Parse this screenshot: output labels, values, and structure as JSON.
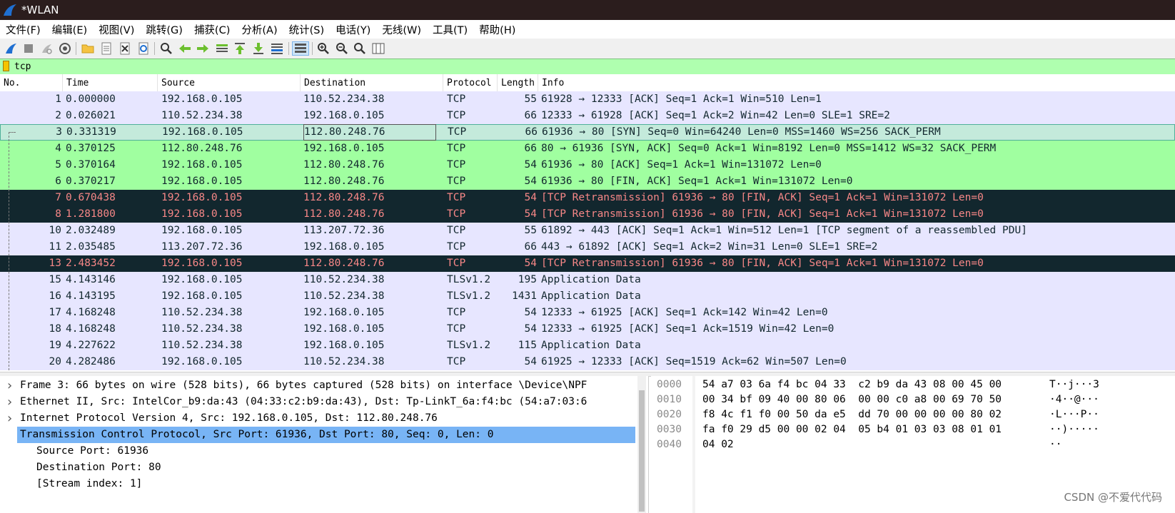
{
  "window": {
    "title": "*WLAN"
  },
  "menu": [
    "文件(F)",
    "编辑(E)",
    "视图(V)",
    "跳转(G)",
    "捕获(C)",
    "分析(A)",
    "统计(S)",
    "电话(Y)",
    "无线(W)",
    "工具(T)",
    "帮助(H)"
  ],
  "toolbar_icons": [
    "start-capture-icon",
    "stop-capture-icon",
    "restart-capture-icon",
    "capture-options-icon",
    "open-file-icon",
    "save-file-icon",
    "close-file-icon",
    "reload-file-icon",
    "find-packet-icon",
    "go-back-icon",
    "go-forward-icon",
    "go-to-packet-icon",
    "first-packet-icon",
    "last-packet-icon",
    "auto-scroll-icon",
    "colorize-icon",
    "zoom-in-icon",
    "zoom-out-icon",
    "zoom-normal-icon",
    "resize-columns-icon"
  ],
  "filter": {
    "value": "tcp"
  },
  "columns": {
    "no": "No.",
    "time": "Time",
    "source": "Source",
    "destination": "Destination",
    "protocol": "Protocol",
    "length": "Length",
    "info": "Info"
  },
  "colors": {
    "tcp": "#e7e6ff",
    "syn": "#a0ffa0",
    "selected": "#c4eadb",
    "bad": "#12272e",
    "bad_text": "#f78787"
  },
  "packets": [
    {
      "no": "1",
      "time": "0.000000",
      "source": "192.168.0.105",
      "destination": "110.52.234.38",
      "protocol": "TCP",
      "length": "55",
      "info": "61928 → 12333 [ACK] Seq=1 Ack=1 Win=510 Len=1",
      "style": "tcp"
    },
    {
      "no": "2",
      "time": "0.026021",
      "source": "110.52.234.38",
      "destination": "192.168.0.105",
      "protocol": "TCP",
      "length": "66",
      "info": "12333 → 61928 [ACK] Seq=1 Ack=2 Win=42 Len=0 SLE=1 SRE=2",
      "style": "tcp"
    },
    {
      "no": "3",
      "time": "0.331319",
      "source": "192.168.0.105",
      "destination": "112.80.248.76",
      "protocol": "TCP",
      "length": "66",
      "info": "61936 → 80 [SYN] Seq=0 Win=64240 Len=0 MSS=1460 WS=256 SACK_PERM",
      "style": "selected"
    },
    {
      "no": "4",
      "time": "0.370125",
      "source": "112.80.248.76",
      "destination": "192.168.0.105",
      "protocol": "TCP",
      "length": "66",
      "info": "80 → 61936 [SYN, ACK] Seq=0 Ack=1 Win=8192 Len=0 MSS=1412 WS=32 SACK_PERM",
      "style": "syn"
    },
    {
      "no": "5",
      "time": "0.370164",
      "source": "192.168.0.105",
      "destination": "112.80.248.76",
      "protocol": "TCP",
      "length": "54",
      "info": "61936 → 80 [ACK] Seq=1 Ack=1 Win=131072 Len=0",
      "style": "syn"
    },
    {
      "no": "6",
      "time": "0.370217",
      "source": "192.168.0.105",
      "destination": "112.80.248.76",
      "protocol": "TCP",
      "length": "54",
      "info": "61936 → 80 [FIN, ACK] Seq=1 Ack=1 Win=131072 Len=0",
      "style": "syn"
    },
    {
      "no": "7",
      "time": "0.670438",
      "source": "192.168.0.105",
      "destination": "112.80.248.76",
      "protocol": "TCP",
      "length": "54",
      "info": "[TCP Retransmission] 61936 → 80 [FIN, ACK] Seq=1 Ack=1 Win=131072 Len=0",
      "style": "bad"
    },
    {
      "no": "8",
      "time": "1.281800",
      "source": "192.168.0.105",
      "destination": "112.80.248.76",
      "protocol": "TCP",
      "length": "54",
      "info": "[TCP Retransmission] 61936 → 80 [FIN, ACK] Seq=1 Ack=1 Win=131072 Len=0",
      "style": "bad"
    },
    {
      "no": "10",
      "time": "2.032489",
      "source": "192.168.0.105",
      "destination": "113.207.72.36",
      "protocol": "TCP",
      "length": "55",
      "info": "61892 → 443 [ACK] Seq=1 Ack=1 Win=512 Len=1 [TCP segment of a reassembled PDU]",
      "style": "tcp"
    },
    {
      "no": "11",
      "time": "2.035485",
      "source": "113.207.72.36",
      "destination": "192.168.0.105",
      "protocol": "TCP",
      "length": "66",
      "info": "443 → 61892 [ACK] Seq=1 Ack=2 Win=31 Len=0 SLE=1 SRE=2",
      "style": "tcp"
    },
    {
      "no": "13",
      "time": "2.483452",
      "source": "192.168.0.105",
      "destination": "112.80.248.76",
      "protocol": "TCP",
      "length": "54",
      "info": "[TCP Retransmission] 61936 → 80 [FIN, ACK] Seq=1 Ack=1 Win=131072 Len=0",
      "style": "bad"
    },
    {
      "no": "15",
      "time": "4.143146",
      "source": "192.168.0.105",
      "destination": "110.52.234.38",
      "protocol": "TLSv1.2",
      "length": "195",
      "info": "Application Data",
      "style": "tcp"
    },
    {
      "no": "16",
      "time": "4.143195",
      "source": "192.168.0.105",
      "destination": "110.52.234.38",
      "protocol": "TLSv1.2",
      "length": "1431",
      "info": "Application Data",
      "style": "tcp"
    },
    {
      "no": "17",
      "time": "4.168248",
      "source": "110.52.234.38",
      "destination": "192.168.0.105",
      "protocol": "TCP",
      "length": "54",
      "info": "12333 → 61925 [ACK] Seq=1 Ack=142 Win=42 Len=0",
      "style": "tcp"
    },
    {
      "no": "18",
      "time": "4.168248",
      "source": "110.52.234.38",
      "destination": "192.168.0.105",
      "protocol": "TCP",
      "length": "54",
      "info": "12333 → 61925 [ACK] Seq=1 Ack=1519 Win=42 Len=0",
      "style": "tcp"
    },
    {
      "no": "19",
      "time": "4.227622",
      "source": "110.52.234.38",
      "destination": "192.168.0.105",
      "protocol": "TLSv1.2",
      "length": "115",
      "info": "Application Data",
      "style": "tcp"
    },
    {
      "no": "20",
      "time": "4.282486",
      "source": "192.168.0.105",
      "destination": "110.52.234.38",
      "protocol": "TCP",
      "length": "54",
      "info": "61925 → 12333 [ACK] Seq=1519 Ack=62 Win=507 Len=0",
      "style": "tcp"
    }
  ],
  "details": [
    {
      "text": "Frame 3: 66 bytes on wire (528 bits), 66 bytes captured (528 bits) on interface \\Device\\NPF",
      "expanded": false,
      "level": 0
    },
    {
      "text": "Ethernet II, Src: IntelCor_b9:da:43 (04:33:c2:b9:da:43), Dst: Tp-LinkT_6a:f4:bc (54:a7:03:6",
      "expanded": false,
      "level": 0
    },
    {
      "text": "Internet Protocol Version 4, Src: 192.168.0.105, Dst: 112.80.248.76",
      "expanded": false,
      "level": 0
    },
    {
      "text": "Transmission Control Protocol, Src Port: 61936, Dst Port: 80, Seq: 0, Len: 0",
      "expanded": true,
      "level": 0,
      "selected": true
    },
    {
      "text": "Source Port: 61936",
      "level": 1
    },
    {
      "text": "Destination Port: 80",
      "level": 1
    },
    {
      "text": "[Stream index: 1]",
      "level": 1
    }
  ],
  "hex": [
    {
      "offset": "0000",
      "bytes": "54 a7 03 6a f4 bc 04 33  c2 b9 da 43 08 00 45 00",
      "ascii": "T··j···3 "
    },
    {
      "offset": "0010",
      "bytes": "00 34 bf 09 40 00 80 06  00 00 c0 a8 00 69 70 50",
      "ascii": "·4··@··· "
    },
    {
      "offset": "0020",
      "bytes": "f8 4c f1 f0 00 50 da e5  dd 70 00 00 00 00 80 02",
      "ascii": "·L···P·· "
    },
    {
      "offset": "0030",
      "bytes": "fa f0 29 d5 00 00 02 04  05 b4 01 03 03 08 01 01",
      "ascii": "··)····· "
    },
    {
      "offset": "0040",
      "bytes": "04 02",
      "ascii": "··"
    }
  ],
  "watermark": "CSDN @不爱代代码"
}
